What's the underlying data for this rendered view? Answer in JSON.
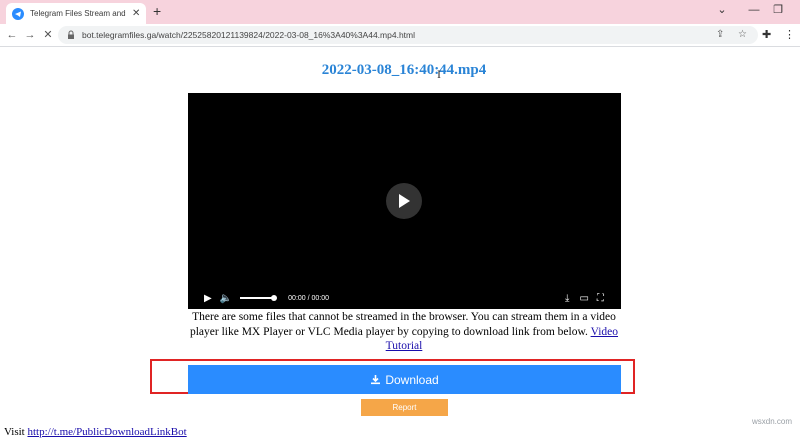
{
  "browser": {
    "tab_title": "Telegram Files Stream and Dow",
    "tab_close": "✕",
    "new_tab": "+",
    "url": "bot.telegramfiles.ga/watch/22525820121139824/2022-03-08_16%3A40%3A44.mp4.html",
    "icons": {
      "back": "back-arrow-icon",
      "forward": "forward-arrow-icon",
      "stop": "close-icon",
      "lock": "lock-icon",
      "share": "share-icon",
      "star": "star-icon",
      "extensions": "puzzle-icon",
      "menu": "kebab-menu-icon"
    }
  },
  "page": {
    "title": "2022-03-08_16:40:44.mp4",
    "video": {
      "time": "00:00 / 00:00"
    },
    "note_text": "There are some files that cannot be streamed in the browser. You can stream them in a video player like MX Player or VLC Media player by copying to download link from below.",
    "note_link": "Video Tutorial",
    "download_label": "Download",
    "report_label": "Report",
    "bottom_prefix": "Visit",
    "bottom_link": "http://t.me/PublicDownloadLinkBot"
  },
  "watermark": "wsxdn.com",
  "colors": {
    "tab_strip": "#f7d3dd",
    "title_blue": "#2a84d6",
    "download_blue": "#2a8cff",
    "report_orange": "#f5a648",
    "highlight_red": "#e02424"
  }
}
